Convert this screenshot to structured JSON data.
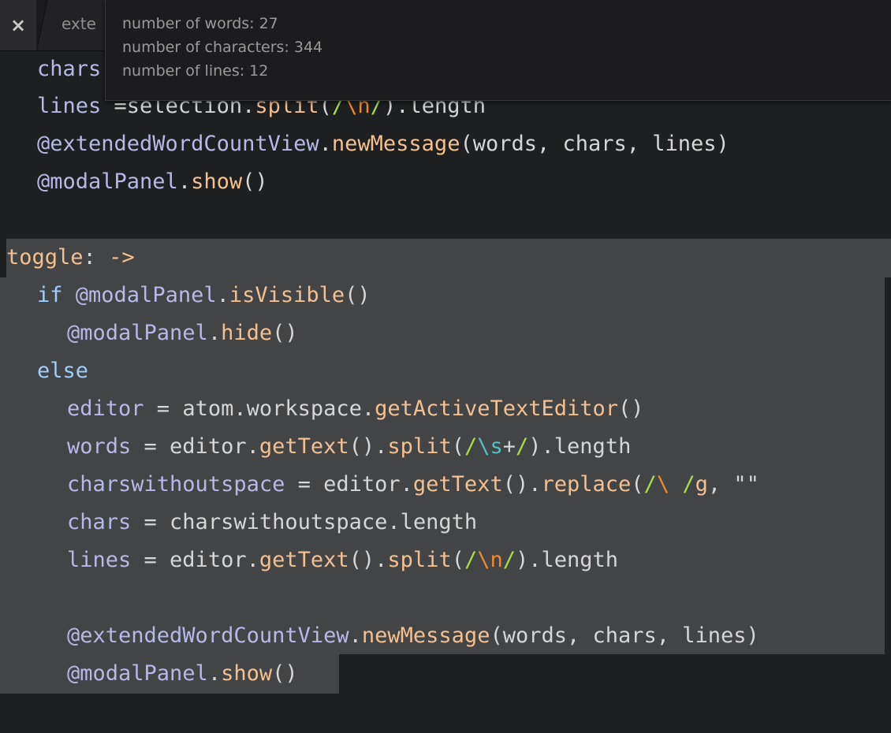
{
  "tab": {
    "close_icon": "×",
    "title": "exte"
  },
  "stats": {
    "words": "number of words: 27",
    "characters": "number of characters: 344",
    "lines": "number of lines: 12"
  },
  "code_lines": [
    "  chars = selection.length",
    "  lines =selection.split(/\\n/).length",
    "  @extendedWordCountView.newMessage(words, chars, lines)",
    "  @modalPanel.show()",
    "",
    "toggle: ->",
    "  if @modalPanel.isVisible()",
    "    @modalPanel.hide()",
    "  else",
    "    editor = atom.workspace.getActiveTextEditor()",
    "    words = editor.getText().split(/\\s+/).length",
    "    charswithoutspace = editor.getText().replace(/\\ /g, \"\")",
    "    chars = charswithoutspace.length",
    "    lines = editor.getText().split(/\\n/).length",
    "",
    "    @extendedWordCountView.newMessage(words, chars, lines)",
    "    @modalPanel.show()"
  ]
}
